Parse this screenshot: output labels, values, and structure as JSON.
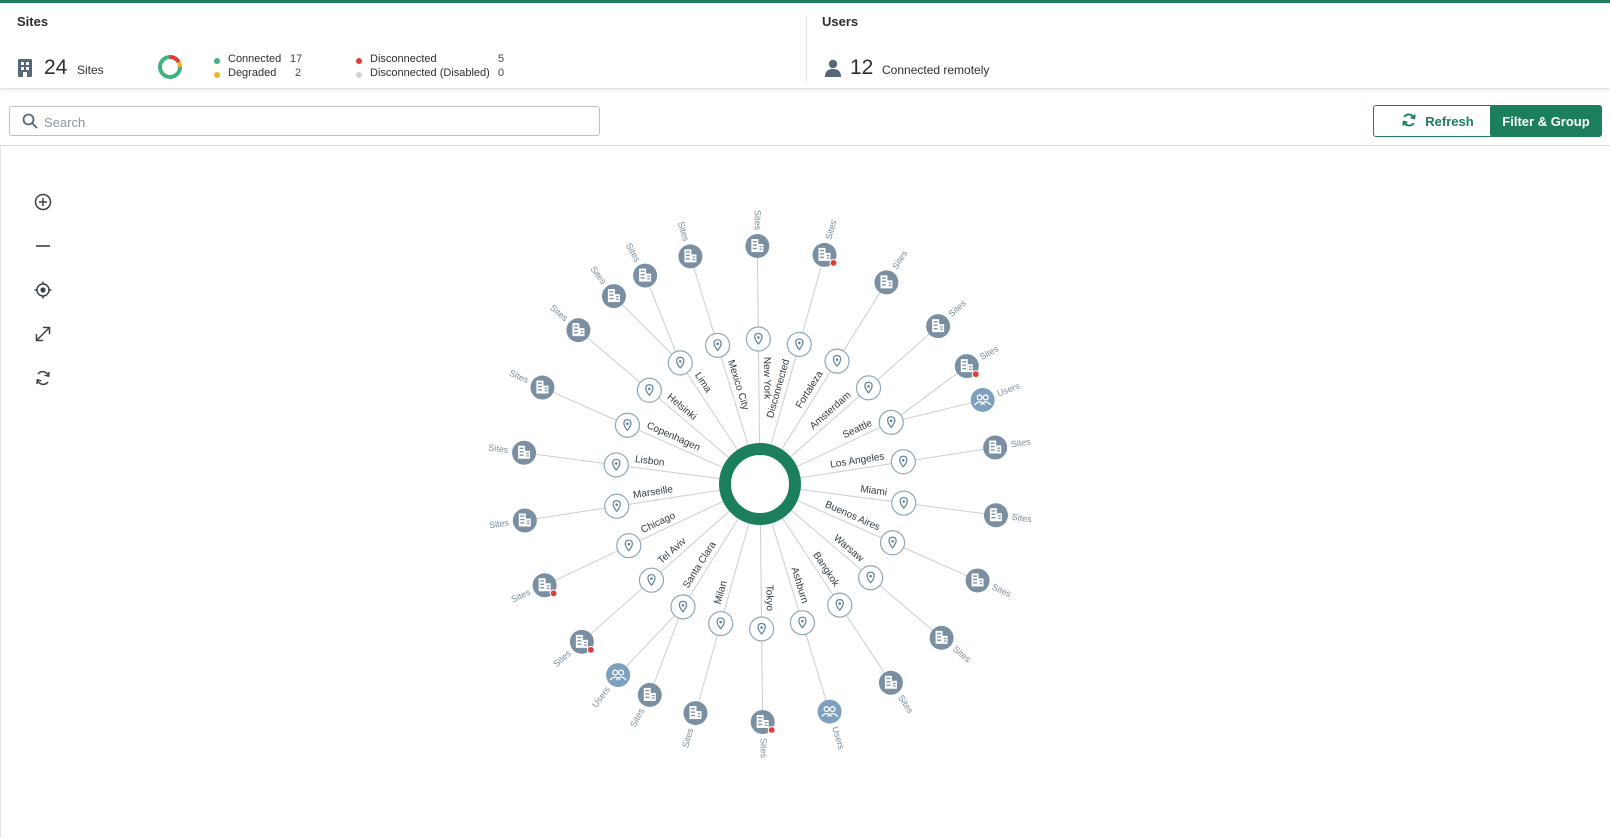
{
  "colors": {
    "accent": "#1a7f5a",
    "connected": "#3fb37f",
    "degraded": "#f0b429",
    "disconnected": "#e53935",
    "disabled": "#cfd5da",
    "node": "#7a8fa2",
    "user_node": "#7ea0bf"
  },
  "sites_panel": {
    "title": "Sites",
    "count": "24",
    "count_label": "Sites",
    "legend": [
      {
        "label": "Connected",
        "value": "17",
        "color": "#3fb37f"
      },
      {
        "label": "Degraded",
        "value": "2",
        "color": "#f0b429"
      },
      {
        "label": "Disconnected",
        "value": "5",
        "color": "#e53935"
      },
      {
        "label": "Disconnected (Disabled)",
        "value": "0",
        "color": "#cfd5da"
      }
    ]
  },
  "users_panel": {
    "title": "Users",
    "count": "12",
    "count_label": "Connected remotely"
  },
  "search": {
    "placeholder": "Search",
    "value": ""
  },
  "toolbar": {
    "refresh_label": "Refresh",
    "filter_label": "Filter & Group"
  },
  "zoom_controls": [
    {
      "name": "zoom-in-icon"
    },
    {
      "name": "zoom-out-icon"
    },
    {
      "name": "center-icon"
    },
    {
      "name": "expand-icon"
    },
    {
      "name": "reset-icon"
    }
  ],
  "graph": {
    "locations": [
      {
        "label": "Mexico City",
        "leaves": [
          {
            "type": "site",
            "label": "Sites",
            "status": "connected"
          }
        ]
      },
      {
        "label": "New York",
        "leaves": [
          {
            "type": "site",
            "label": "Sites",
            "status": "connected"
          }
        ]
      },
      {
        "label": "Disconnected",
        "leaves": [
          {
            "type": "site",
            "label": "Sites",
            "status": "disconnected"
          }
        ]
      },
      {
        "label": "Fortaleza",
        "leaves": [
          {
            "type": "site",
            "label": "Sites",
            "status": "connected"
          }
        ]
      },
      {
        "label": "Amsterdam",
        "leaves": [
          {
            "type": "site",
            "label": "Sites",
            "status": "connected"
          }
        ]
      },
      {
        "label": "Seattle",
        "leaves": [
          {
            "type": "site",
            "label": "Sites",
            "status": "disconnected"
          },
          {
            "type": "users",
            "label": "Users",
            "status": "connected"
          }
        ]
      },
      {
        "label": "Los Angeles",
        "leaves": [
          {
            "type": "site",
            "label": "Sites",
            "status": "connected"
          }
        ]
      },
      {
        "label": "Miami",
        "leaves": [
          {
            "type": "site",
            "label": "Sites",
            "status": "connected"
          }
        ]
      },
      {
        "label": "Buenos Aires",
        "leaves": [
          {
            "type": "site",
            "label": "Sites",
            "status": "connected"
          }
        ]
      },
      {
        "label": "Warsaw",
        "leaves": [
          {
            "type": "site",
            "label": "Sites",
            "status": "connected"
          }
        ]
      },
      {
        "label": "Bangkok",
        "leaves": [
          {
            "type": "site",
            "label": "Sites",
            "status": "connected"
          }
        ]
      },
      {
        "label": "Ashburn",
        "leaves": [
          {
            "type": "users",
            "label": "Users",
            "status": "connected"
          }
        ]
      },
      {
        "label": "Tokyo",
        "leaves": [
          {
            "type": "site",
            "label": "Sites",
            "status": "disconnected"
          }
        ]
      },
      {
        "label": "Milan",
        "leaves": [
          {
            "type": "site",
            "label": "Sites",
            "status": "connected"
          }
        ]
      },
      {
        "label": "Santa Clara",
        "leaves": [
          {
            "type": "site",
            "label": "Sites",
            "status": "connected"
          },
          {
            "type": "users",
            "label": "Users",
            "status": "connected"
          }
        ]
      },
      {
        "label": "Tel Aviv",
        "leaves": [
          {
            "type": "site",
            "label": "Sites",
            "status": "disconnected"
          }
        ]
      },
      {
        "label": "Chicago",
        "leaves": [
          {
            "type": "site",
            "label": "Sites",
            "status": "disconnected"
          }
        ]
      },
      {
        "label": "Marseille",
        "leaves": [
          {
            "type": "site",
            "label": "Sites",
            "status": "connected"
          }
        ]
      },
      {
        "label": "Lisbon",
        "leaves": [
          {
            "type": "site",
            "label": "Sites",
            "status": "connected"
          }
        ]
      },
      {
        "label": "Copenhagen",
        "leaves": [
          {
            "type": "site",
            "label": "Sites",
            "status": "connected"
          }
        ]
      },
      {
        "label": "Helsinki",
        "leaves": [
          {
            "type": "site",
            "label": "Sites",
            "status": "connected"
          }
        ]
      },
      {
        "label": "Lima",
        "leaves": [
          {
            "type": "site",
            "label": "Sites",
            "status": "connected"
          },
          {
            "type": "site",
            "label": "Sites",
            "status": "connected"
          }
        ]
      }
    ]
  }
}
